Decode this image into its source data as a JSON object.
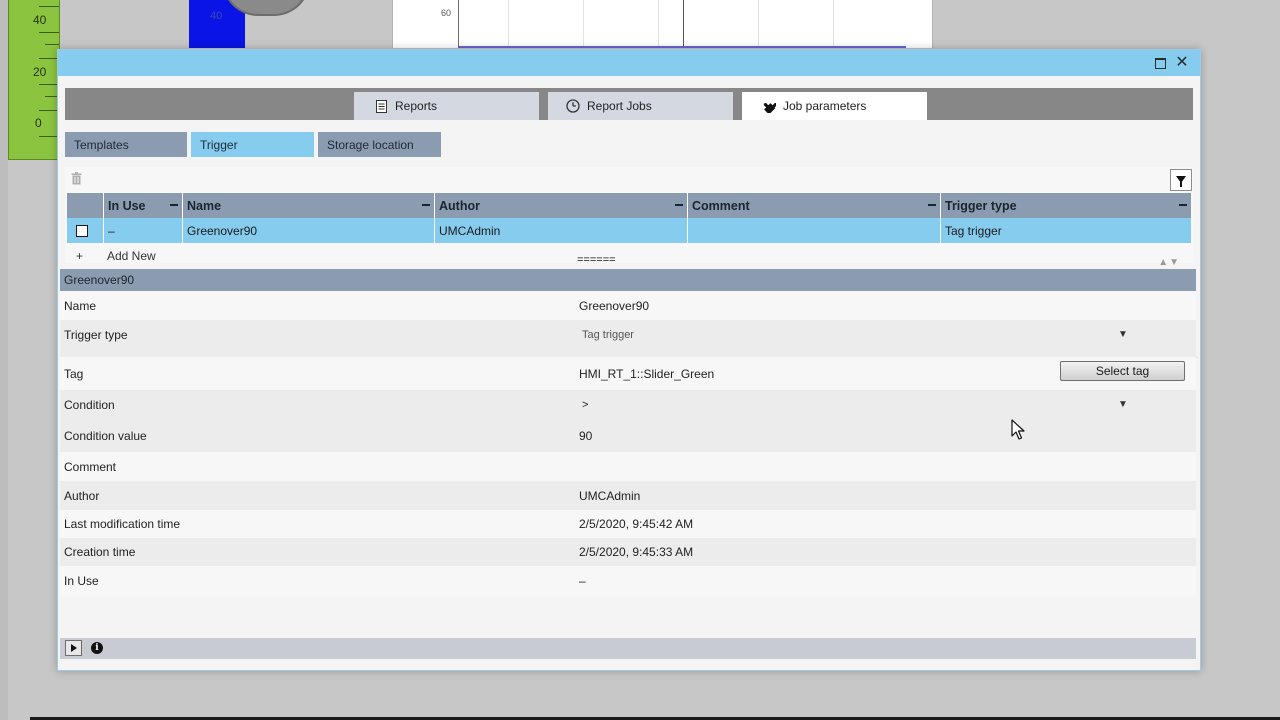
{
  "background": {
    "gauge_labels": [
      "40",
      "20",
      "0"
    ],
    "gauge_color": "#8bc53f",
    "blue_bar_label": "40",
    "chart_tick_label": "60"
  },
  "dialog": {
    "accent_color": "#86ccef",
    "tabs": [
      {
        "label": "Reports",
        "icon": "report-document-icon"
      },
      {
        "label": "Report Jobs",
        "icon": "clock-icon"
      },
      {
        "label": "Job parameters",
        "icon": "puzzle-icon",
        "active": true
      }
    ],
    "subtabs": [
      {
        "label": "Templates"
      },
      {
        "label": "Trigger",
        "active": true
      },
      {
        "label": "Storage location"
      }
    ],
    "table": {
      "columns": [
        "In Use",
        "Name",
        "Author",
        "Comment",
        "Trigger type"
      ],
      "rows": [
        {
          "in_use": "–",
          "name": "Greenover90",
          "author": "UMCAdmin",
          "comment": "",
          "trigger_type": "Tag trigger"
        }
      ],
      "add_new_label": "Add New",
      "add_new_symbol": "+",
      "splitter_label": "======",
      "sort_arrows": "▲▼"
    },
    "detail": {
      "header": "Greenover90",
      "properties": {
        "name": {
          "label": "Name",
          "value": "Greenover90"
        },
        "trigger_type": {
          "label": "Trigger type",
          "value": "Tag trigger"
        },
        "tag": {
          "label": "Tag",
          "value": "HMI_RT_1::Slider_Green",
          "button": "Select tag"
        },
        "condition": {
          "label": "Condition",
          "value": ">"
        },
        "condition_value": {
          "label": "Condition value",
          "value": "90"
        },
        "comment": {
          "label": "Comment",
          "value": ""
        },
        "author": {
          "label": "Author",
          "value": "UMCAdmin"
        },
        "last_modification_time": {
          "label": "Last modification time",
          "value": "2/5/2020, 9:45:42 AM"
        },
        "creation_time": {
          "label": "Creation time",
          "value": "2/5/2020, 9:45:33 AM"
        },
        "in_use": {
          "label": "In Use",
          "value": "–"
        }
      }
    },
    "status": {
      "info_symbol": "i"
    }
  }
}
